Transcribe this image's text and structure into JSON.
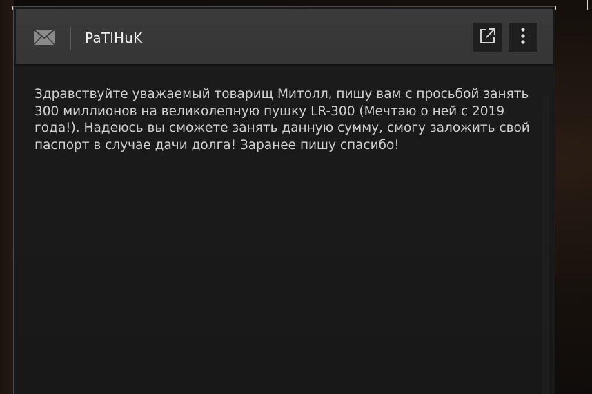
{
  "mail": {
    "sender": "PaTlHuK",
    "body": "Здравствуйте уважаемый товарищ Митолл, пишу вам с просьбой занять 300 миллионов на великолепную пушку LR-300 (Мечтаю о ней с 2019 года!). Надеюсь вы сможете занять данную сумму, смогу заложить свой паспорт в случае дачи долга! Заранее пишу спасибо!"
  },
  "icons": {
    "mail": "mail-icon",
    "open_external": "open-external-icon",
    "more": "more-options-icon"
  },
  "colors": {
    "header_bg": "#3b3b3b",
    "body_bg": "#1b1b1b",
    "text": "#cfcfcf",
    "button_bg": "#1f1f1f"
  }
}
